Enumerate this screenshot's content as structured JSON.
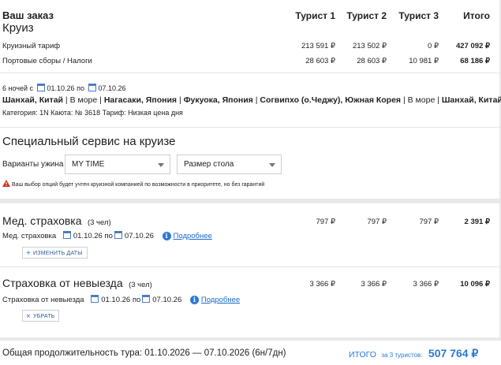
{
  "order": {
    "title": "Ваш заказ",
    "subtitle": "Круиз",
    "tourist_headers": [
      "Турист 1",
      "Турист 2",
      "Турист 3"
    ],
    "total_header": "Итого",
    "rows": [
      {
        "label": "Круизный тариф",
        "values": [
          "213 591 ₽",
          "213 502 ₽",
          "0 ₽"
        ],
        "total": "427 092 ₽"
      },
      {
        "label": "Портовые сборы / Налоги",
        "values": [
          "28 603 ₽",
          "28 603 ₽",
          "10 981 ₽"
        ],
        "total": "68 186 ₽"
      }
    ]
  },
  "cruise": {
    "nights": "6 ночей с",
    "date_from": "01.10.26",
    "by": "по",
    "date_to": "07.10.26",
    "route": [
      {
        "text": "Шанхай, Китай",
        "bold": true
      },
      {
        "text": " | ",
        "bold": false
      },
      {
        "text": "В море",
        "bold": false
      },
      {
        "text": " | ",
        "bold": false
      },
      {
        "text": "Нагасаки, Япония",
        "bold": true
      },
      {
        "text": " | ",
        "bold": false
      },
      {
        "text": "Фукуока, Япония",
        "bold": true
      },
      {
        "text": " | ",
        "bold": false
      },
      {
        "text": "Согвипхо (о.Чеджу), Южная Корея",
        "bold": true
      },
      {
        "text": " | ",
        "bold": false
      },
      {
        "text": "В море",
        "bold": false
      },
      {
        "text": " | ",
        "bold": false
      },
      {
        "text": "Шанхай, Китай",
        "bold": true
      }
    ],
    "details": "Категория: 1N  Каюта: № 3618  Тариф: Низкая цена дня"
  },
  "special_service": {
    "title": "Специальный сервис на круизе",
    "dinner_label": "Варианты ужина",
    "dinner_value": "MY TIME",
    "table_size_placeholder": "Размер стола",
    "warning": "Ваш выбор опций будет учтен круизной компанией по возможности в приоритете, но без гарантий"
  },
  "insurance_medical": {
    "title": "Мед. страховка",
    "count": "(3 чел)",
    "values": [
      "797 ₽",
      "797 ₽",
      "797 ₽"
    ],
    "total": "2 391 ₽",
    "sub_label": "Мед. страховка",
    "date_from": "01.10.26",
    "by": "по",
    "date_to": "07.10.26",
    "more_link": "Подробнее",
    "change_button": "изменить даты"
  },
  "insurance_cancel": {
    "title": "Страховка от невыезда",
    "count": "(3 чел)",
    "values": [
      "3 366 ₽",
      "3 366 ₽",
      "3 366 ₽"
    ],
    "total": "10 096 ₽",
    "sub_label": "Страховка от невыезда",
    "date_from": "01.10.26",
    "by": "по",
    "date_to": "07.10.26",
    "more_link": "Подробнее",
    "remove_button": "убрать"
  },
  "footer": {
    "duration": "Общая продолжительность тура: 01.10.2026 — 07.10.2026 (6н/7дн)",
    "total_label": "ИТОГО",
    "total_for": "за 3 туристов:",
    "total_value": "507 764 ₽"
  },
  "colors": {
    "accent": "#2a7ad5",
    "warning": "#d9301c"
  },
  "icons": [
    "calendar-icon",
    "info-icon",
    "plus-icon",
    "close-icon",
    "warning-icon",
    "chevron-down-icon"
  ]
}
